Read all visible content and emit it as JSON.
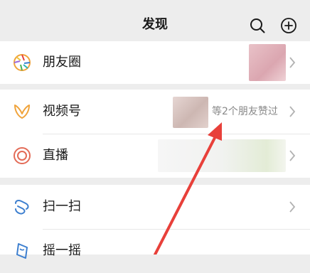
{
  "header": {
    "title": "发现",
    "icons": [
      "search-icon",
      "add-icon"
    ]
  },
  "items": {
    "moments": {
      "label": "朋友圈",
      "icon": "moments-icon"
    },
    "channels": {
      "label": "视频号",
      "icon": "channels-icon",
      "note": "等2个朋友赞过"
    },
    "live": {
      "label": "直播",
      "icon": "live-icon"
    },
    "scan": {
      "label": "扫一扫",
      "icon": "scan-icon"
    },
    "shake": {
      "label": "摇一摇",
      "icon": "shake-icon"
    }
  },
  "colors": {
    "background": "#ededed",
    "row_background": "#ffffff",
    "secondary_text": "#888888",
    "annotation_arrow": "#e8403a",
    "icon_orange": "#f0a33a",
    "icon_red": "#e36b57",
    "icon_blue": "#3d7fcf"
  }
}
